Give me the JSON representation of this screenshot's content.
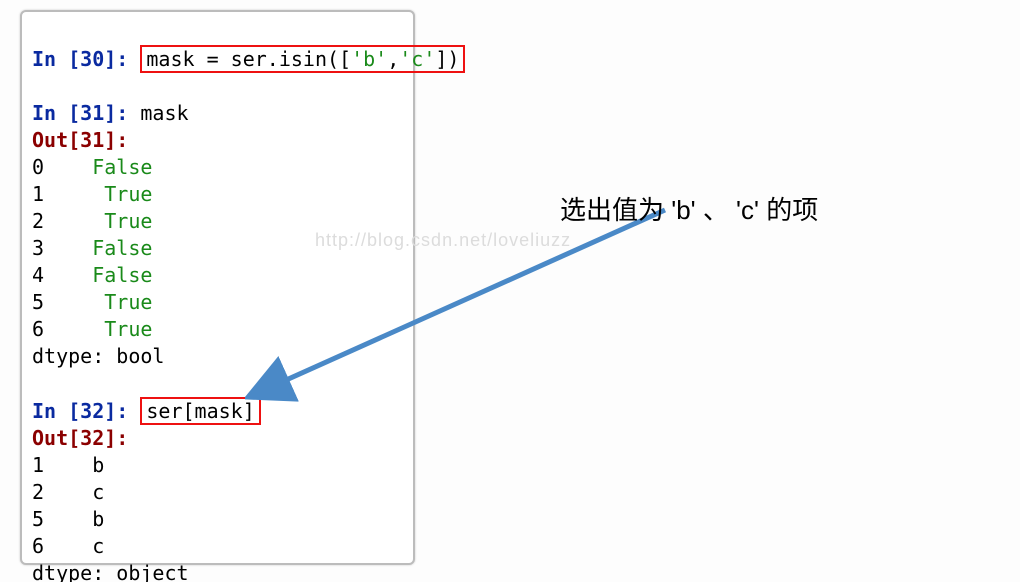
{
  "cells": {
    "c30": {
      "in_label": "In [",
      "in_num": "30",
      "in_close": "]: ",
      "code_pre": "mask = ser.isin([",
      "arg1": "'b'",
      "comma": ",",
      "arg2": "'c'",
      "code_post": "])"
    },
    "c31": {
      "in_label": "In [",
      "in_num": "31",
      "in_close": "]: ",
      "code": "mask",
      "out_label": "Out[",
      "out_num": "31",
      "out_close": "]:",
      "rows": [
        {
          "idx": "0",
          "val": "False"
        },
        {
          "idx": "1",
          "val": "True"
        },
        {
          "idx": "2",
          "val": "True"
        },
        {
          "idx": "3",
          "val": "False"
        },
        {
          "idx": "4",
          "val": "False"
        },
        {
          "idx": "5",
          "val": "True"
        },
        {
          "idx": "6",
          "val": "True"
        }
      ],
      "dtype": "dtype: bool"
    },
    "c32": {
      "in_label": "In [",
      "in_num": "32",
      "in_close": "]: ",
      "code": "ser[mask]",
      "out_label": "Out[",
      "out_num": "32",
      "out_close": "]:",
      "rows": [
        {
          "idx": "1",
          "val": "b"
        },
        {
          "idx": "2",
          "val": "c"
        },
        {
          "idx": "5",
          "val": "b"
        },
        {
          "idx": "6",
          "val": "c"
        }
      ],
      "dtype": "dtype: object"
    }
  },
  "annotation": "选出值为 'b' 、 'c' 的项",
  "watermark": "http://blog.csdn.net/loveliuzz",
  "colors": {
    "in": "#0a2aa0",
    "out": "#8b0000",
    "border_red": "#e11",
    "arrow": "#4a89c7"
  }
}
